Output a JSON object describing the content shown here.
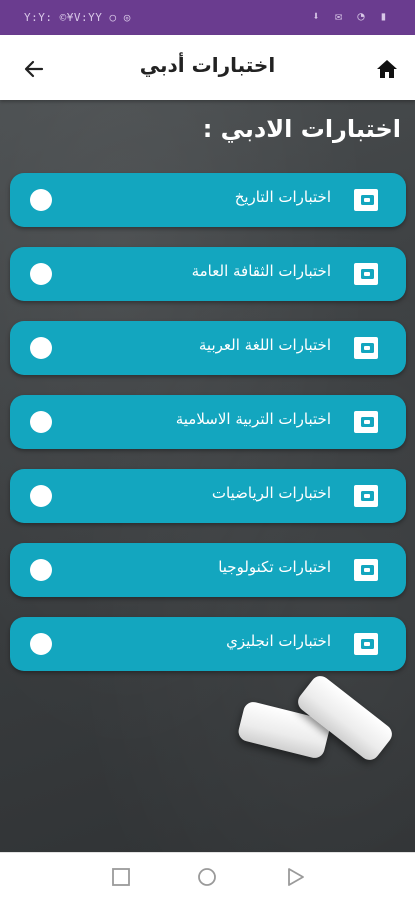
{
  "status_bar": {
    "time": "Y:Y: ©¥V:YY ○ ◎",
    "icons": "⬇ ✉ ◔ ▮"
  },
  "app_bar": {
    "title": "اختبارات أدبي",
    "back_icon": "arrow-left",
    "home_icon": "home"
  },
  "main": {
    "heading": "اختبارات الادبي :",
    "items": [
      {
        "label": "اختبارات التاريخ"
      },
      {
        "label": "اختبارات الثقافة العامة"
      },
      {
        "label": "اختبارات اللغة العربية"
      },
      {
        "label": "اختبارات التربية الاسلامية"
      },
      {
        "label": "اختبارات الرياضيات"
      },
      {
        "label": "اختبارات تكنولوجيا"
      },
      {
        "label": "اختبارات انجليزي"
      }
    ]
  },
  "colors": {
    "status_bar": "#6a3c8f",
    "item_bg": "#13a6bf",
    "background": "#3b3e40"
  },
  "nav_bar": {
    "icons": [
      "square-recents",
      "circle-home",
      "triangle-back"
    ]
  }
}
